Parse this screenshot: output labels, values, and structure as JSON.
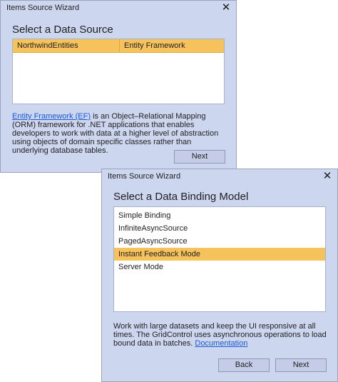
{
  "window1": {
    "title": "Items Source Wizard",
    "close_glyph": "✕",
    "heading": "Select a Data Source",
    "table": {
      "row": [
        "NorthwindEntities",
        "Entity Framework"
      ]
    },
    "description": {
      "link": "Entity Framework (EF)",
      "text": " is an Object–Relational Mapping (ORM) framework for .NET applications that enables developers to work with data at a higher level of abstraction using objects of domain specific classes rather than underlying database tables."
    },
    "next_label": "Next"
  },
  "window2": {
    "title": "Items Source Wizard",
    "close_glyph": "✕",
    "heading": "Select a Data Binding Model",
    "items": [
      "Simple Binding",
      "InfiniteAsyncSource",
      "PagedAsyncSource",
      "Instant Feedback Mode",
      "Server Mode"
    ],
    "selected_index": 3,
    "description": {
      "text": "Work with large datasets and keep the UI responsive at all times. The GridControl uses asynchronous operations to load bound data in batches. ",
      "link": "Documentation"
    },
    "back_label": "Back",
    "next_label": "Next"
  },
  "colors": {
    "window_bg": "#cdd6ef",
    "selection": "#f6c25b",
    "link": "#1a5ad6"
  }
}
